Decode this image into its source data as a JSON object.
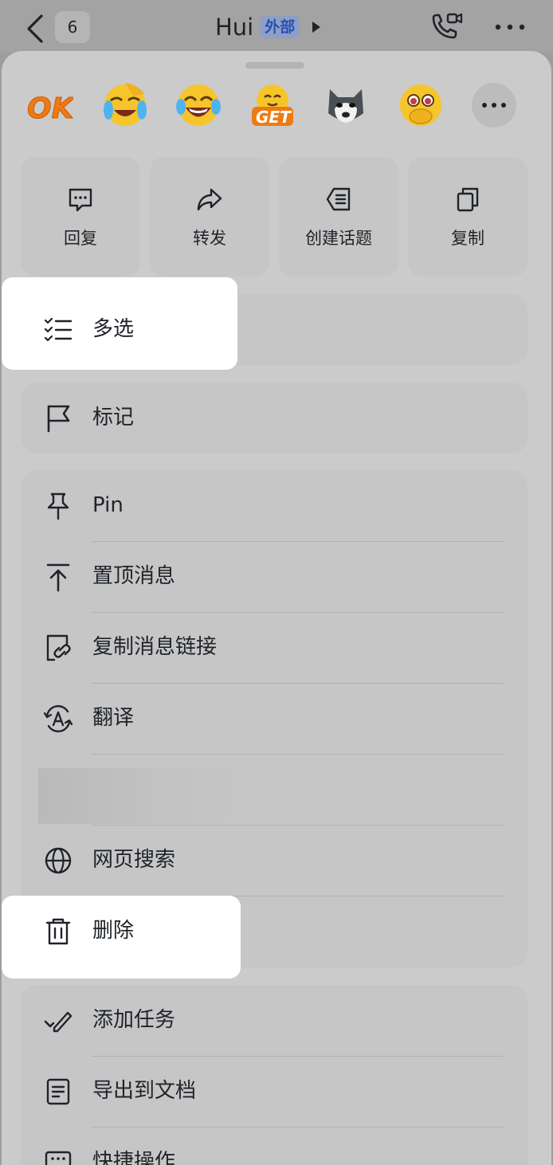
{
  "topbar": {
    "badge_count": "6",
    "chat_name": "Hui",
    "external_tag": "外部"
  },
  "emoji_reactions": [
    "ok",
    "face-with-tears-of-joy-covering",
    "laughing-face",
    "get-emoji",
    "husky-dog",
    "pleading-face-covering-mouth"
  ],
  "quick_actions": [
    {
      "label": "回复",
      "icon": "reply-icon"
    },
    {
      "label": "转发",
      "icon": "forward-icon"
    },
    {
      "label": "创建话题",
      "icon": "create-topic-icon"
    },
    {
      "label": "复制",
      "icon": "copy-icon"
    }
  ],
  "menu": {
    "multi_select": "多选",
    "mark": "标记",
    "pin": "Pin",
    "pin_top": "置顶消息",
    "copy_link": "复制消息链接",
    "translate": "翻译",
    "web_search": "网页搜索",
    "delete": "删除",
    "add_task": "添加任务",
    "export_doc": "导出到文档",
    "quick_action": "快捷操作"
  },
  "emoji_text": {
    "ok": "OK",
    "get": "GET"
  }
}
